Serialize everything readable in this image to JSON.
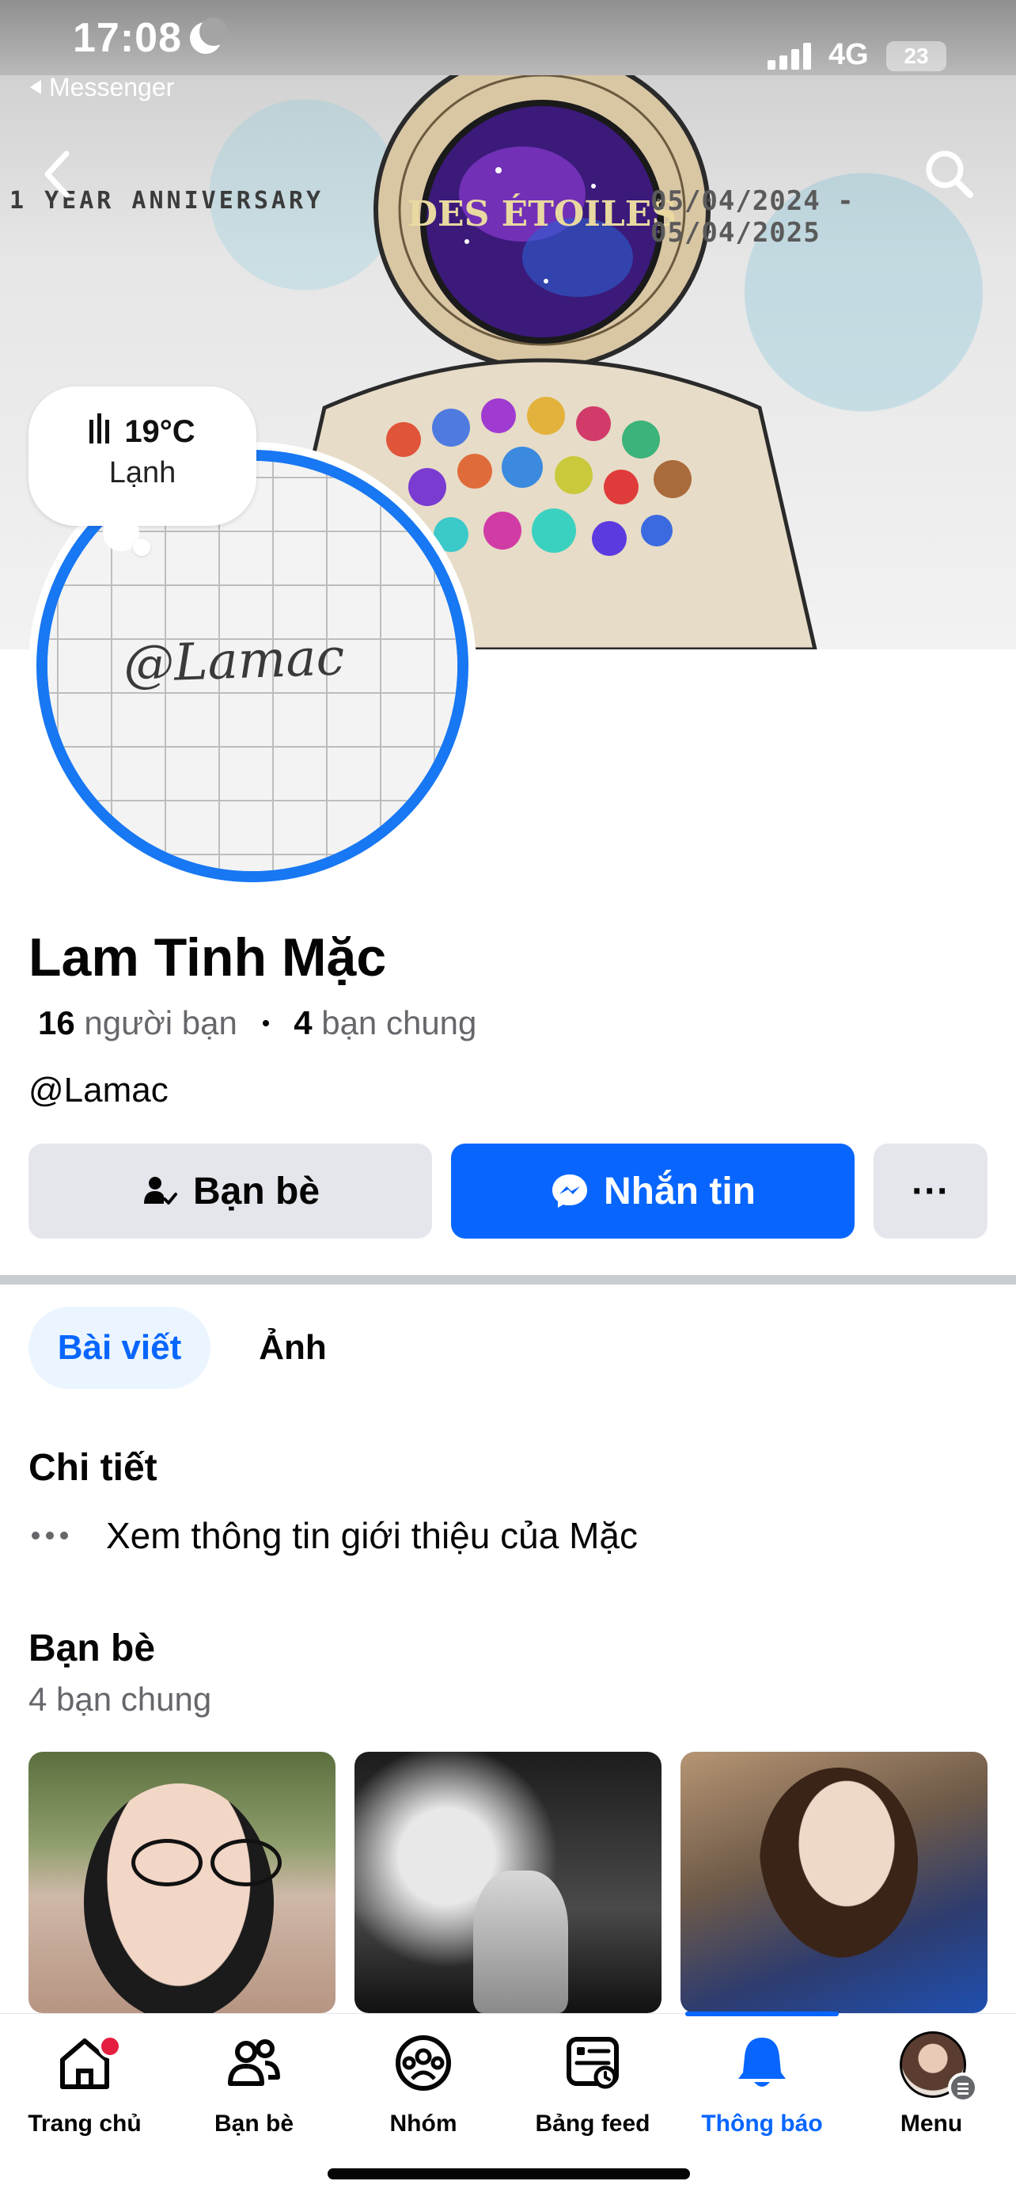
{
  "status_bar": {
    "time": "17:08",
    "network": "4G",
    "battery": "23",
    "back_app": "Messenger"
  },
  "cover": {
    "banner_left": "1 YEAR ANNIVERSARY",
    "banner_right": "05/04/2024 - 05/04/2025",
    "art_text": "DES ÉTOILES"
  },
  "avatar": {
    "handwritten": "@Lamac"
  },
  "weather": {
    "temperature": "19°C",
    "condition": "Lạnh"
  },
  "profile": {
    "name": "Lam Tinh Mặc",
    "friends_count": "16",
    "friends_label": "người bạn",
    "mutual_count": "4",
    "mutual_label": "bạn chung",
    "username": "@Lamac"
  },
  "actions": {
    "friends_label": "Bạn bè",
    "message_label": "Nhắn tin",
    "more_label": "···"
  },
  "tabs": [
    {
      "label": "Bài viết",
      "active": true
    },
    {
      "label": "Ảnh",
      "active": false
    }
  ],
  "details": {
    "title": "Chi tiết",
    "about_link": "Xem thông tin giới thiệu của Mặc"
  },
  "friends": {
    "title": "Bạn bè",
    "subtitle": "4 bạn chung"
  },
  "bottom_nav": [
    {
      "label": "Trang chủ",
      "icon": "home-icon",
      "active": false,
      "badge": true
    },
    {
      "label": "Bạn bè",
      "icon": "friends-icon",
      "active": false
    },
    {
      "label": "Nhóm",
      "icon": "groups-icon",
      "active": false
    },
    {
      "label": "Bảng feed",
      "icon": "feed-icon",
      "active": false
    },
    {
      "label": "Thông báo",
      "icon": "bell-icon",
      "active": true
    },
    {
      "label": "Menu",
      "icon": "menu-avatar-icon",
      "active": false
    }
  ],
  "colors": {
    "accent": "#0866ff",
    "button_gray": "#e4e6eb",
    "badge_red": "#e41e3f",
    "secondary_text": "#65676b"
  }
}
